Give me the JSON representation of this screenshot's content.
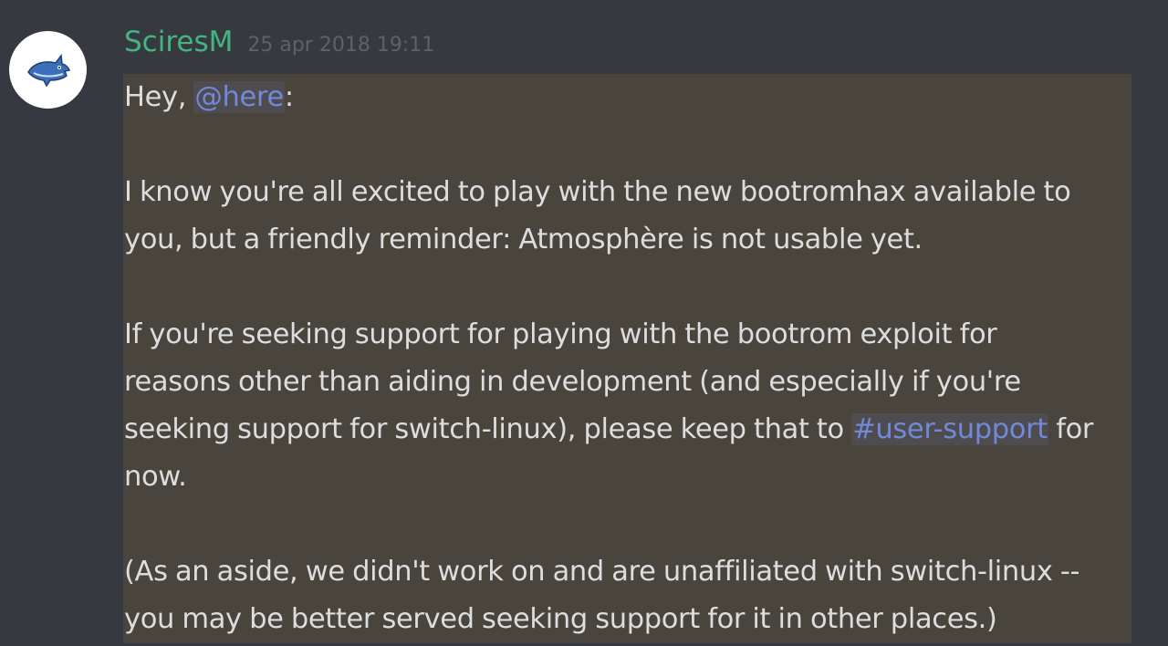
{
  "author": {
    "name": "SciresM",
    "timestamp": "25 apr 2018 19:11",
    "name_color": "#43b581",
    "avatar_icon": "shark-icon"
  },
  "message": {
    "greeting_prefix": "Hey, ",
    "mention_here": "@here",
    "greeting_suffix": ":",
    "p1_line1": "I know you're all excited to play with the new bootromhax available to",
    "p1_line2": "you, but a friendly reminder: Atmosphère is not usable yet.",
    "p2_line1": "If you're seeking support for playing with the bootrom exploit for",
    "p2_line2": "reasons other than aiding in development (and especially if you're",
    "p2_line3_prefix": "seeking support for switch-linux), please keep that to ",
    "channel_mention": "#user-support",
    "p2_line3_suffix": " for",
    "p2_line4": "now.",
    "p3_line1": "(As an aside, we didn't work on and are unaffiliated with switch-linux --",
    "p3_line2": "you may be better served seeking support for it in other places.)"
  },
  "colors": {
    "background": "#36393f",
    "highlight": "#49443c",
    "mention": "#7289da"
  }
}
